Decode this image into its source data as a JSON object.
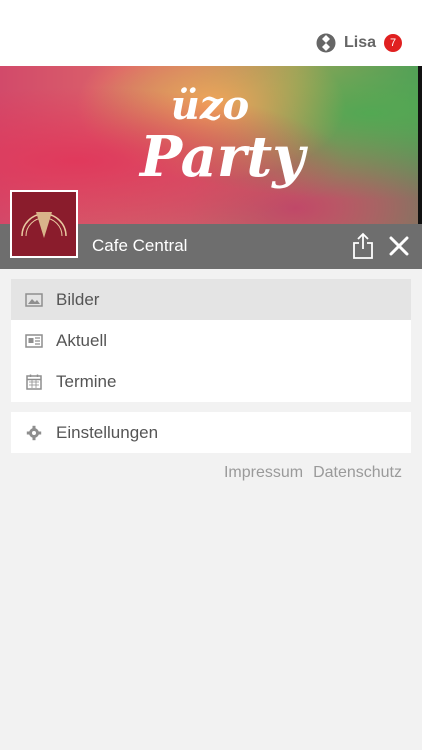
{
  "user": {
    "name": "Lisa",
    "notification_count": "7"
  },
  "banner": {
    "logo_top": "üzo",
    "logo_bottom": "Party"
  },
  "venue": {
    "name": "Cafe Central"
  },
  "menu": {
    "items": [
      {
        "label": "Bilder",
        "icon": "image-icon",
        "active": true
      },
      {
        "label": "Aktuell",
        "icon": "newspaper-icon",
        "active": false
      },
      {
        "label": "Termine",
        "icon": "calendar-icon",
        "active": false
      }
    ],
    "settings": {
      "label": "Einstellungen",
      "icon": "gear-icon"
    }
  },
  "footer": {
    "impressum": "Impressum",
    "datenschutz": "Datenschutz"
  },
  "colors": {
    "badge": "#e02020",
    "venue_bar": "#6e6e6e",
    "active_item": "#e4e4e4"
  }
}
